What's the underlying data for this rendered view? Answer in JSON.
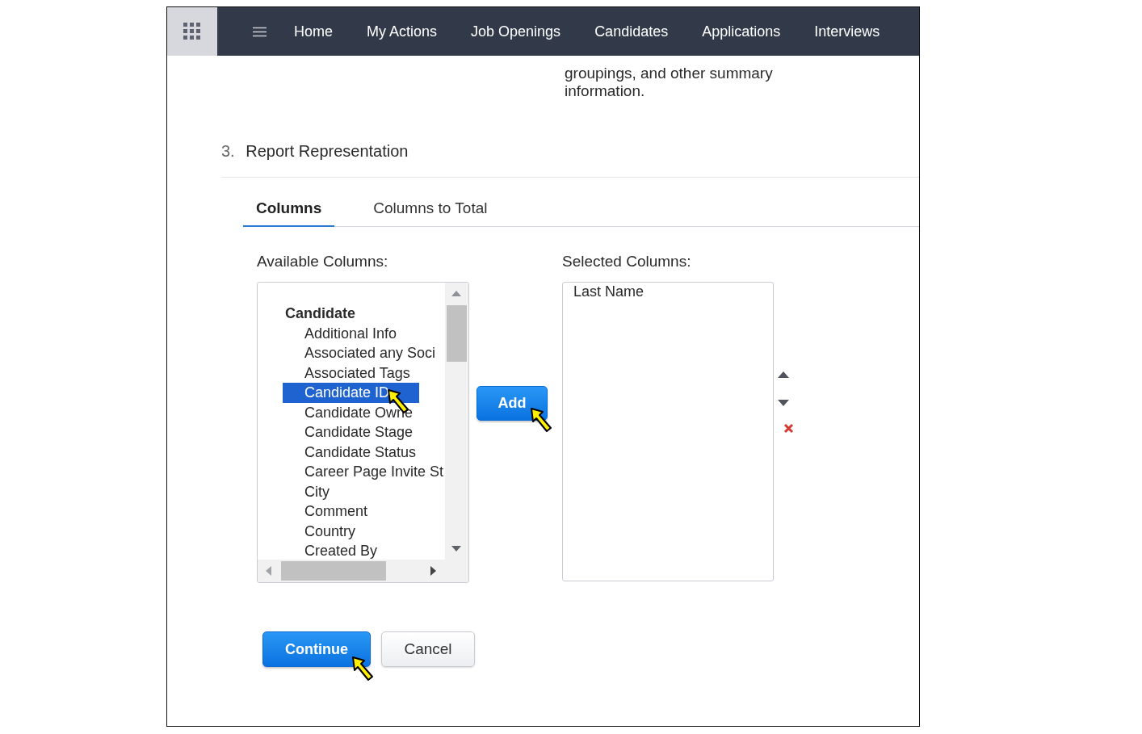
{
  "nav": {
    "items": [
      "Home",
      "My Actions",
      "Job Openings",
      "Candidates",
      "Applications",
      "Interviews"
    ]
  },
  "intro": {
    "right_lines": [
      "groupings, and other summary",
      "information."
    ]
  },
  "section": {
    "number": "3.",
    "title": "Report Representation"
  },
  "tabs": [
    {
      "label": "Columns",
      "selected": true
    },
    {
      "label": "Columns to Total",
      "selected": false
    }
  ],
  "available": {
    "label": "Available Columns:",
    "groups": [
      {
        "name": "Candidate",
        "children": [
          {
            "label": "Additional Info",
            "selected": false
          },
          {
            "label": "Associated any Soci",
            "selected": false
          },
          {
            "label": "Associated Tags",
            "selected": false
          },
          {
            "label": "Candidate ID",
            "selected": true
          },
          {
            "label": "Candidate Owne",
            "selected": false
          },
          {
            "label": "Candidate Stage",
            "selected": false
          },
          {
            "label": "Candidate Status",
            "selected": false
          },
          {
            "label": "Career Page Invite St",
            "selected": false
          },
          {
            "label": "City",
            "selected": false
          },
          {
            "label": "Comment",
            "selected": false
          },
          {
            "label": "Country",
            "selected": false
          },
          {
            "label": "Created By",
            "selected": false
          }
        ]
      }
    ]
  },
  "selected_columns": {
    "label": "Selected Columns:",
    "items": [
      {
        "label": "Last Name"
      }
    ]
  },
  "buttons": {
    "add": "Add",
    "continue": "Continue",
    "cancel": "Cancel"
  }
}
